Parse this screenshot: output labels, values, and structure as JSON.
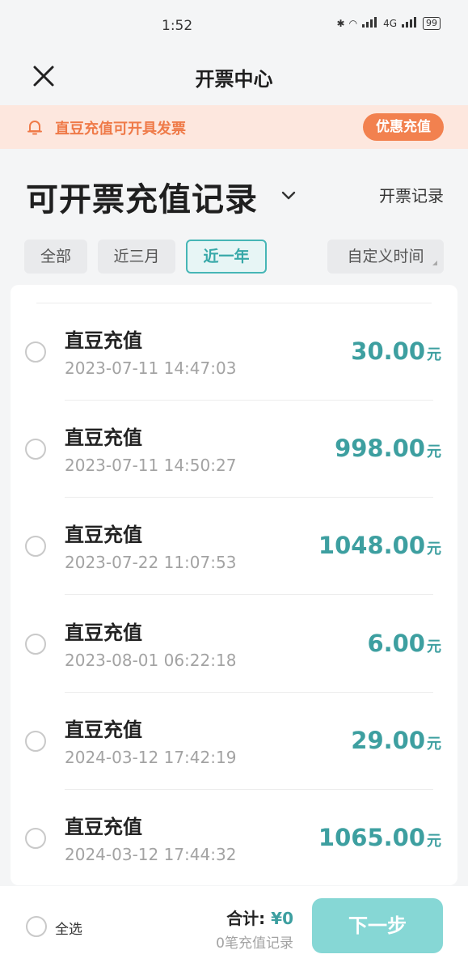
{
  "status_bar": {
    "time": "1:52",
    "network": "4G",
    "battery": "99"
  },
  "navbar": {
    "title": "开票中心"
  },
  "notice": {
    "text": "直豆充值可开具发票",
    "promo_button": "优惠充值"
  },
  "header": {
    "title": "可开票充值记录",
    "records_link": "开票记录"
  },
  "filters": [
    {
      "label": "全部",
      "active": false
    },
    {
      "label": "近三月",
      "active": false
    },
    {
      "label": "近一年",
      "active": true
    },
    {
      "label": "自定义时间",
      "active": false
    }
  ],
  "records": [
    {
      "name": "直豆充值",
      "date": "2023-07-11 14:47:03",
      "amount": "30.00",
      "unit": "元"
    },
    {
      "name": "直豆充值",
      "date": "2023-07-11 14:50:27",
      "amount": "998.00",
      "unit": "元"
    },
    {
      "name": "直豆充值",
      "date": "2023-07-22 11:07:53",
      "amount": "1048.00",
      "unit": "元"
    },
    {
      "name": "直豆充值",
      "date": "2023-08-01 06:22:18",
      "amount": "6.00",
      "unit": "元"
    },
    {
      "name": "直豆充值",
      "date": "2024-03-12 17:42:19",
      "amount": "29.00",
      "unit": "元"
    },
    {
      "name": "直豆充值",
      "date": "2024-03-12 17:44:32",
      "amount": "1065.00",
      "unit": "元"
    }
  ],
  "bottom": {
    "select_all": "全选",
    "total_label": "合计:",
    "total_value": "¥0",
    "count_text": "0笔充值记录",
    "next_button": "下一步"
  },
  "colors": {
    "accent": "#3d9fa0",
    "notice_bg": "#fde7de",
    "notice_text": "#ef7a48",
    "promo_bg": "#f2814f",
    "next_bg": "#86d7d5"
  }
}
